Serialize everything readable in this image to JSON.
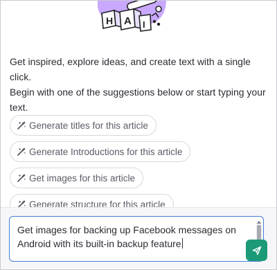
{
  "intro": {
    "line1": "Get inspired, explore ideas, and create text with a single click.",
    "line2": "Begin with one of the suggestions below or start typing your text."
  },
  "suggestions": [
    {
      "label": "Generate titles for this article",
      "icon": "magic-wand-icon"
    },
    {
      "label": "Generate Introductions for this article",
      "icon": "magic-wand-icon"
    },
    {
      "label": "Get images for this article",
      "icon": "magic-wand-icon"
    },
    {
      "label": "Generate structure for this article",
      "icon": "magic-wand-icon"
    }
  ],
  "composer": {
    "value": "Get images for backing up Facebook messages on Android with its built-in backup feature",
    "send_icon": "send-icon"
  },
  "illustration": {
    "letters": [
      "H",
      "A",
      "I"
    ]
  },
  "colors": {
    "accent": "#1c9a78",
    "input_border": "#3f7fd6",
    "illustration_purple": "#c9a8ff"
  }
}
